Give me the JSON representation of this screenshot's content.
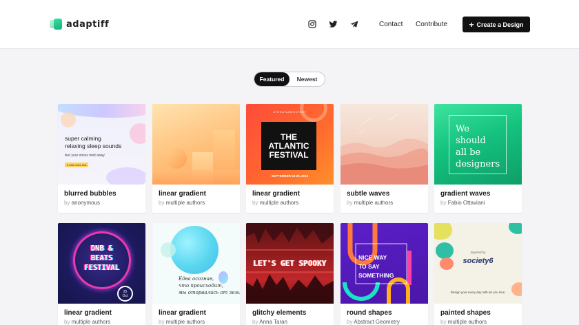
{
  "brand": {
    "name": "adaptiff"
  },
  "nav": {
    "contact": "Contact",
    "contribute": "Contribute",
    "create_label": "Create a Design"
  },
  "tabs": {
    "featured": "Featured",
    "newest": "Newest"
  },
  "by_label": "by",
  "cards": [
    {
      "title": "blurred bubbles",
      "author": "anonymous",
      "art": {
        "line1": "super calming",
        "line2": "relaxing sleep sounds",
        "sub": "feel your stress melt away",
        "tag": "2,455 notes fast"
      }
    },
    {
      "title": "linear gradient",
      "author": "multiple authors"
    },
    {
      "title": "linear gradient",
      "author": "multiple authors",
      "art": {
        "hashtag": "#THEATLANTICFEST",
        "line1": "THE",
        "line2": "ATLANTIC",
        "line3": "FESTIVAL",
        "date": "SEPTEMBER 24-26, 2019"
      }
    },
    {
      "title": "subtle waves",
      "author": "multiple authors"
    },
    {
      "title": "gradient waves",
      "author": "Fabio Ottaviani",
      "art": {
        "line1": "We",
        "line2": "should",
        "line3": "all be",
        "line4": "designers"
      }
    },
    {
      "title": "linear gradient",
      "author": "multiple authors",
      "art": {
        "line1": "DNB &",
        "line2": "BEATS",
        "line3": "FESTIVAL",
        "day": "25",
        "month": "Oct"
      }
    },
    {
      "title": "linear gradient",
      "author": "multiple authors",
      "art": {
        "line1": "Едва осознав,",
        "line2": "что происходит,",
        "line3": "мы оторвались от земли"
      }
    },
    {
      "title": "glitchy elements",
      "author": "Anna Taran",
      "art": {
        "line1": "LET'S GET SPOOKY"
      }
    },
    {
      "title": "round shapes",
      "author": "Abstract Geometry",
      "art": {
        "line1": "NICE WAY",
        "line2": "TO SAY",
        "line3": "SOMETHING"
      }
    },
    {
      "title": "painted shapes",
      "author": "multiple authors",
      "art": {
        "inspired": "Inspired by",
        "brand": "society6",
        "tagline": "Design your every day with art you love."
      }
    }
  ]
}
